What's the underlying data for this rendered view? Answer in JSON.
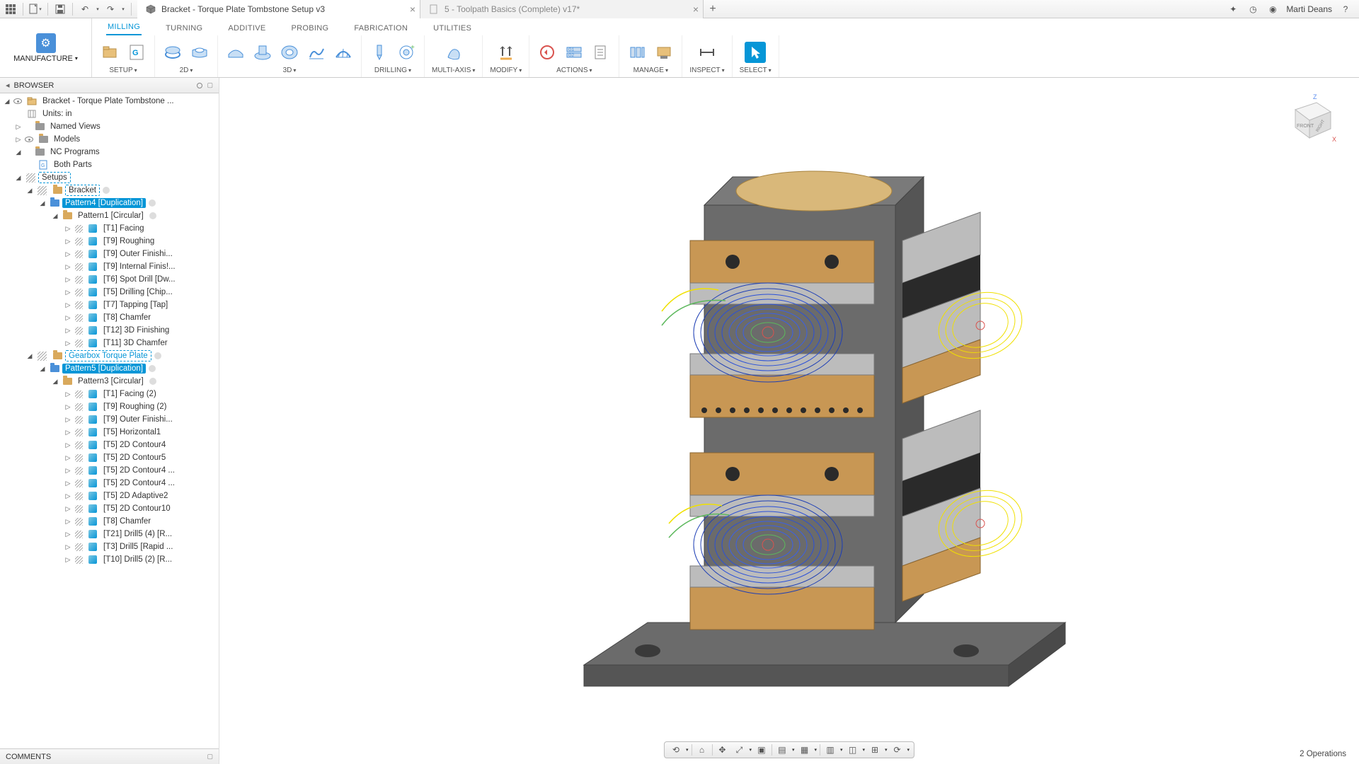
{
  "topbar": {
    "tabs": [
      {
        "title": "Bracket - Torque Plate Tombstone Setup v3",
        "active": true
      },
      {
        "title": "5 - Toolpath Basics (Complete) v17*",
        "active": false
      }
    ],
    "user": "Marti Deans"
  },
  "workspace": {
    "label": "MANUFACTURE"
  },
  "ribbon": {
    "tabs": [
      "MILLING",
      "TURNING",
      "ADDITIVE",
      "PROBING",
      "FABRICATION",
      "UTILITIES"
    ],
    "active_tab": "MILLING",
    "groups": [
      "SETUP",
      "2D",
      "3D",
      "DRILLING",
      "MULTI-AXIS",
      "MODIFY",
      "ACTIONS",
      "MANAGE",
      "INSPECT",
      "SELECT"
    ]
  },
  "browser": {
    "title": "BROWSER",
    "root": "Bracket - Torque Plate Tombstone ...",
    "units": "Units: in",
    "named_views": "Named Views",
    "models": "Models",
    "nc_programs": "NC Programs",
    "both_parts": "Both Parts",
    "setups": "Setups",
    "bracket_setup": "Bracket",
    "pattern4": "Pattern4 [Duplication]",
    "pattern1": "Pattern1 [Circular]",
    "ops1": [
      "[T1] Facing",
      "[T9] Roughing",
      "[T9] Outer Finishi...",
      "[T9] Internal Finis!...",
      "[T6] Spot Drill [Dw...",
      "[T5] Drilling [Chip...",
      "[T7] Tapping [Tap]",
      "[T8] Chamfer",
      "[T12] 3D Finishing",
      "[T11] 3D Chamfer"
    ],
    "gearbox_setup": "Gearbox Torque Plate",
    "pattern5": "Pattern5 [Duplication]",
    "pattern3": "Pattern3 [Circular]",
    "ops2": [
      "[T1] Facing (2)",
      "[T9] Roughing (2)",
      "[T9] Outer Finishi...",
      "[T5] Horizontal1",
      "[T5] 2D Contour4",
      "[T5] 2D Contour5",
      "[T5] 2D Contour4 ...",
      "[T5] 2D Contour4 ...",
      "[T5] 2D Adaptive2",
      "[T5] 2D Contour10",
      "[T8] Chamfer",
      "[T21] Drill5 (4) [R...",
      "[T3] Drill5 [Rapid ...",
      "[T10] Drill5 (2) [R..."
    ]
  },
  "comments_label": "COMMENTS",
  "status": {
    "right": "2 Operations"
  },
  "viewcube": {
    "front": "FRONT",
    "right": "RIGHT",
    "z": "Z",
    "x": "X"
  }
}
